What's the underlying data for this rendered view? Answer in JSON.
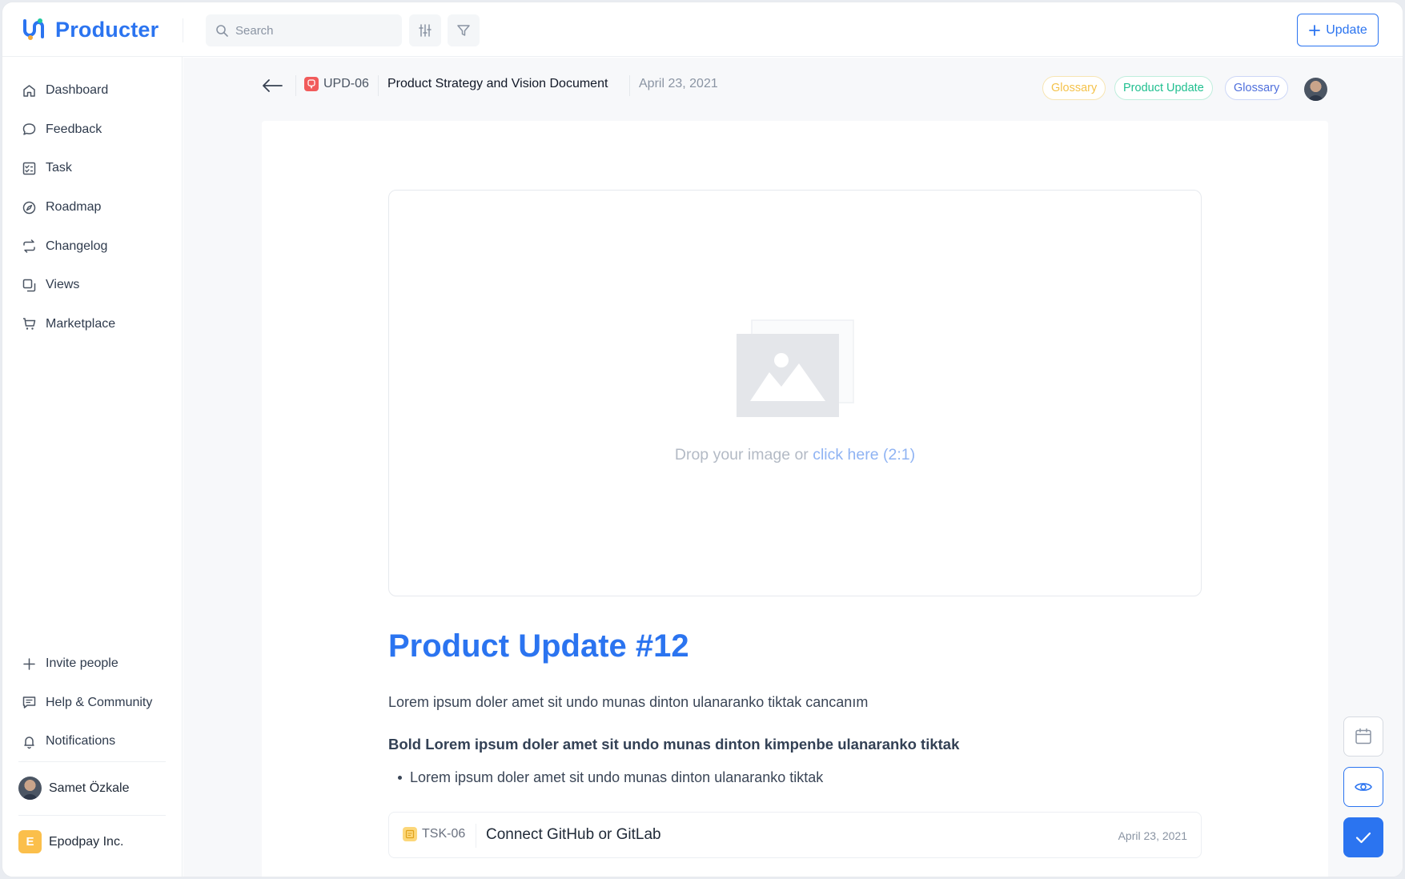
{
  "app": {
    "name": "Producter",
    "brand_color": "#2b74f0"
  },
  "topbar": {
    "search_placeholder": "Search",
    "update_label": "Update"
  },
  "sidebar": {
    "items": [
      {
        "label": "Dashboard",
        "icon": "home-icon"
      },
      {
        "label": "Feedback",
        "icon": "chat-bubble-icon"
      },
      {
        "label": "Task",
        "icon": "checklist-icon"
      },
      {
        "label": "Roadmap",
        "icon": "compass-icon"
      },
      {
        "label": "Changelog",
        "icon": "refresh-icon"
      },
      {
        "label": "Views",
        "icon": "copy-icon"
      },
      {
        "label": "Marketplace",
        "icon": "cart-icon"
      }
    ],
    "bottom_items": [
      {
        "label": "Invite people",
        "icon": "plus-icon"
      },
      {
        "label": "Help & Community",
        "icon": "message-icon"
      },
      {
        "label": "Notifications",
        "icon": "bell-icon"
      }
    ],
    "user": {
      "name": "Samet Özkale"
    },
    "org": {
      "initial": "E",
      "name": "Epodpay Inc."
    }
  },
  "document": {
    "id": "UPD-06",
    "title": "Product Strategy and Vision Document",
    "date": "April 23, 2021",
    "tags": [
      {
        "label": "Glossary",
        "color": "#f4c24a"
      },
      {
        "label": "Product Update",
        "color": "#1fbf8f"
      },
      {
        "label": "Glossary",
        "color": "#4f6fdc"
      }
    ],
    "dropzone": {
      "text": "Drop your image or ",
      "link": "click here (2:1)"
    },
    "headline": "Product Update #12",
    "paragraph": "Lorem ipsum doler amet sit undo munas dinton ulanaranko tiktak cancanım",
    "bold_paragraph": "Bold Lorem ipsum doler amet sit undo munas dinton kimpenbe ulanaranko tiktak",
    "bullets": [
      "Lorem ipsum doler amet sit undo munas dinton ulanaranko tiktak"
    ],
    "linked_task": {
      "id": "TSK-06",
      "title": "Connect GitHub or GitLab",
      "date": "April 23, 2021"
    }
  },
  "actions": [
    {
      "name": "calendar-icon"
    },
    {
      "name": "eye-icon"
    },
    {
      "name": "check-icon"
    }
  ]
}
